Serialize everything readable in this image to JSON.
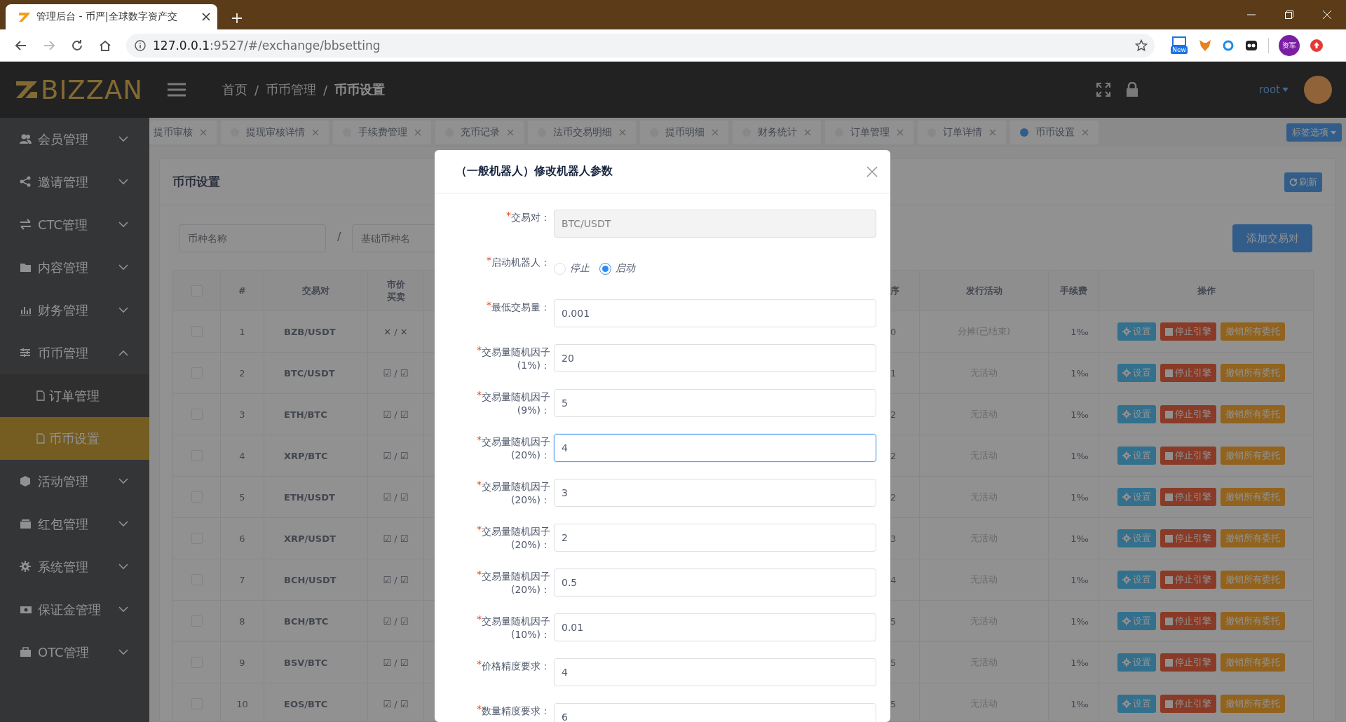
{
  "browser": {
    "tab_title": "管理后台 - 币严|全球数字资产交",
    "url_host": "127.0.0.1",
    "url_path": ":9527/#/exchange/bbsetting",
    "extension_badge": "New",
    "profile_text": "资军"
  },
  "header": {
    "logo": "BIZZAN",
    "breadcrumb": [
      {
        "label": "首页",
        "current": false
      },
      {
        "label": "币币管理",
        "current": false
      },
      {
        "label": "币币设置",
        "current": true
      }
    ],
    "separator": "/",
    "user": "root"
  },
  "sidebar": {
    "items": [
      {
        "label": "会员管理",
        "expanded": false
      },
      {
        "label": "邀请管理",
        "expanded": false
      },
      {
        "label": "CTC管理",
        "expanded": false
      },
      {
        "label": "内容管理",
        "expanded": false
      },
      {
        "label": "财务管理",
        "expanded": false
      },
      {
        "label": "币币管理",
        "expanded": true,
        "children": [
          {
            "label": "订单管理",
            "selected": false
          },
          {
            "label": "币币设置",
            "selected": true
          }
        ]
      },
      {
        "label": "活动管理",
        "expanded": false
      },
      {
        "label": "红包管理",
        "expanded": false
      },
      {
        "label": "系统管理",
        "expanded": false
      },
      {
        "label": "保证金管理",
        "expanded": false
      },
      {
        "label": "OTC管理",
        "expanded": false
      }
    ]
  },
  "tabs": [
    {
      "label": "提币审核",
      "kind": "partial",
      "selected": false
    },
    {
      "label": "提现审核详情",
      "kind": "full",
      "selected": false
    },
    {
      "label": "手续费管理",
      "kind": "full",
      "selected": false
    },
    {
      "label": "充币记录",
      "kind": "full",
      "selected": false
    },
    {
      "label": "法币交易明细",
      "kind": "full",
      "selected": false
    },
    {
      "label": "提币明细",
      "kind": "full",
      "selected": false
    },
    {
      "label": "财务统计",
      "kind": "full",
      "selected": false
    },
    {
      "label": "订单管理",
      "kind": "full",
      "selected": false
    },
    {
      "label": "订单详情",
      "kind": "full",
      "selected": false
    },
    {
      "label": "币币设置",
      "kind": "full",
      "selected": true
    }
  ],
  "tab_options": "标签选项",
  "panel": {
    "title": "币币设置",
    "refresh": "刷新",
    "filters": [
      {
        "placeholder": "币种名称"
      },
      {
        "placeholder": "基础币种名"
      }
    ],
    "filter_separator": "/",
    "add_button": "添加交易对"
  },
  "table": {
    "header_checked": false,
    "columns": [
      "#",
      "交易对",
      "市价买卖",
      "序",
      "发行活动",
      "手续费",
      "操作"
    ],
    "rows": [
      {
        "checked": false,
        "index": "1",
        "pair": "BZB/USDT",
        "market": "✕ / ✕",
        "sort": "0",
        "activity": "分摊(已结束)",
        "fee": "1‰",
        "actions": [
          "设置",
          "停止引擎",
          "撤销所有委托"
        ]
      },
      {
        "checked": false,
        "index": "2",
        "pair": "BTC/USDT",
        "market": "☑ / ☑",
        "sort": "1",
        "activity": "无活动",
        "fee": "1‰",
        "actions": [
          "设置",
          "停止引擎",
          "撤销所有委托"
        ]
      },
      {
        "checked": false,
        "index": "3",
        "pair": "ETH/BTC",
        "market": "☑ / ☑",
        "sort": "2",
        "activity": "无活动",
        "fee": "1‰",
        "actions": [
          "设置",
          "停止引擎",
          "撤销所有委托"
        ]
      },
      {
        "checked": false,
        "index": "4",
        "pair": "XRP/BTC",
        "market": "☑ / ☑",
        "sort": "2",
        "activity": "无活动",
        "fee": "1‰",
        "actions": [
          "设置",
          "停止引擎",
          "撤销所有委托"
        ]
      },
      {
        "checked": false,
        "index": "5",
        "pair": "ETH/USDT",
        "market": "☑ / ☑",
        "sort": "2",
        "activity": "无活动",
        "fee": "1‰",
        "actions": [
          "设置",
          "停止引擎",
          "撤销所有委托"
        ]
      },
      {
        "checked": false,
        "index": "6",
        "pair": "XRP/USDT",
        "market": "☑ / ☑",
        "sort": "3",
        "activity": "无活动",
        "fee": "1‰",
        "actions": [
          "设置",
          "停止引擎",
          "撤销所有委托"
        ]
      },
      {
        "checked": false,
        "index": "7",
        "pair": "BCH/USDT",
        "market": "☑ / ☑",
        "sort": "4",
        "activity": "无活动",
        "fee": "1‰",
        "actions": [
          "设置",
          "停止引擎",
          "撤销所有委托"
        ]
      },
      {
        "checked": false,
        "index": "8",
        "pair": "BCH/BTC",
        "market": "☑ / ☑",
        "sort": "5",
        "activity": "无活动",
        "fee": "1‰",
        "actions": [
          "设置",
          "停止引擎",
          "撤销所有委托"
        ]
      },
      {
        "checked": false,
        "index": "9",
        "pair": "BSV/BTC",
        "market": "☑ / ☑",
        "sort": "5",
        "activity": "无活动",
        "fee": "1‰",
        "actions": [
          "设置",
          "停止引擎",
          "撤销所有委托"
        ]
      },
      {
        "checked": false,
        "index": "10",
        "pair": "EOS/BTC",
        "market": "☑ / ☑",
        "sort": "5",
        "activity": "无活动",
        "fee": "1‰",
        "actions": [
          "设置",
          "停止引擎",
          "撤销所有委托"
        ]
      }
    ]
  },
  "modal": {
    "title": "（一般机器人）修改机器人参数",
    "fields": [
      {
        "kind": "text",
        "required_mark": "*",
        "label": "交易对：",
        "value": "BTC/USDT",
        "disabled": true,
        "focused": false
      },
      {
        "kind": "radio",
        "required_mark": "*",
        "label": "启动机器人：",
        "options": [
          {
            "label": "停止",
            "selected": false
          },
          {
            "label": "启动",
            "selected": true
          }
        ]
      },
      {
        "kind": "text",
        "required_mark": "*",
        "label": "最低交易量：",
        "value": "0.001",
        "disabled": false,
        "focused": false
      },
      {
        "kind": "text",
        "required_mark": "*",
        "label": "交易量随机因子(1%)：",
        "value": "20",
        "disabled": false,
        "focused": false
      },
      {
        "kind": "text",
        "required_mark": "*",
        "label": "交易量随机因子(9%)：",
        "value": "5",
        "disabled": false,
        "focused": false
      },
      {
        "kind": "text",
        "required_mark": "*",
        "label": "交易量随机因子(20%)：",
        "value": "4",
        "disabled": false,
        "focused": true
      },
      {
        "kind": "text",
        "required_mark": "*",
        "label": "交易量随机因子(20%)：",
        "value": "3",
        "disabled": false,
        "focused": false
      },
      {
        "kind": "text",
        "required_mark": "*",
        "label": "交易量随机因子(20%)：",
        "value": "2",
        "disabled": false,
        "focused": false
      },
      {
        "kind": "text",
        "required_mark": "*",
        "label": "交易量随机因子(20%)：",
        "value": "0.5",
        "disabled": false,
        "focused": false
      },
      {
        "kind": "text",
        "required_mark": "*",
        "label": "交易量随机因子(10%)：",
        "value": "0.01",
        "disabled": false,
        "focused": false
      },
      {
        "kind": "text",
        "required_mark": "*",
        "label": "价格精度要求：",
        "value": "4",
        "disabled": false,
        "focused": false
      },
      {
        "kind": "text",
        "required_mark": "*",
        "label": "数量精度要求：",
        "value": "6",
        "disabled": false,
        "focused": false
      }
    ]
  }
}
